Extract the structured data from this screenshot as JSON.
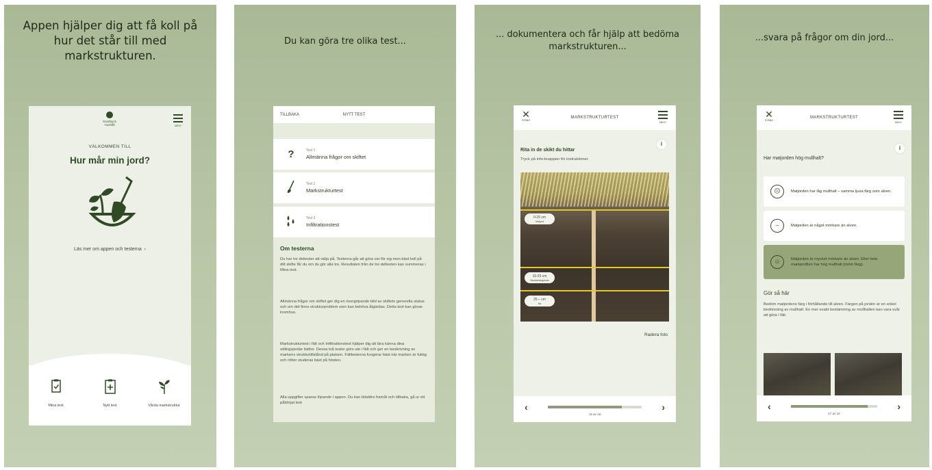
{
  "captions": {
    "p1": "Appen hjälper dig att få koll på hur det står till med markstrukturen.",
    "p2": "Du kan göra tre olika test...",
    "p3": "... dokumentera och får hjälp att bedöma markstrukturen...",
    "p4": "...svara på frågor om din jord..."
  },
  "screen1": {
    "logo_text": "Svartbyns Hushåll",
    "menu_label": "MENY",
    "welcome": "VÄLKOMMEN TILL",
    "title": "Hur mår min jord?",
    "more_link": "Läs mer om appen och testerna",
    "tabs": [
      {
        "label": "Mina test",
        "icon": "clipboard-check-icon"
      },
      {
        "label": "Nytt test",
        "icon": "clipboard-plus-icon"
      },
      {
        "label": "Vårda markstruktur",
        "icon": "sprout-icon"
      }
    ]
  },
  "screen2": {
    "back": "TILLBAKA",
    "title": "NYTT TEST",
    "tests": [
      {
        "small": "Test 1",
        "name": "Allmänna frågor om skiftet",
        "icon": "question-icon"
      },
      {
        "small": "Test 2",
        "name": "Markstrukturtest",
        "icon": "shovel-icon"
      },
      {
        "small": "Test 3",
        "name": "Infiltrationstest",
        "icon": "droplets-icon"
      }
    ],
    "about_title": "Om testerna",
    "paragraphs": [
      "Du har tre deltester att välja på. Testerna går att göra var för sig men bäst koll på ditt skifte får du om du gör alla tre. Resultaten från de tre deltesten kan summeras i Mina test.",
      "Allmänna frågor om skiftet ger dig en övergripande bild av skiftets generella status och om det finns strukturproblem som kan behöva åtgärdas. Detta test kan göras inomhus.",
      "Markstrukturtest i fält och Infiltrationstest hjälper dig att lära känna dina odlingsjordar bättre. Dessa två tester görs ute i fält och ger en beskrivning av markens strukturtillstånd på platsen. Fälttesterna fungerar bäst när marken är fuktig och rötter studeras bäst på hösten.",
      "Alla uppgifter sparas löpande i appen. Du kan bläddra framåt och tillbaka, gå ur ett påbörjat test"
    ]
  },
  "screen3": {
    "close": "STÄNG",
    "title": "MARKSTRUKTURTEST",
    "menu_label": "MENY",
    "heading": "Rita in de skikt du hittar",
    "subheading": "Tryck på info-knappen för instruktioner.",
    "layers": [
      "0-25 cm",
      "10-25 cm",
      "25 – cm"
    ],
    "layer_sub": [
      "Matjord",
      "Bearbetningssula",
      "Alv"
    ],
    "delete": "Radera foto",
    "progress_text": "15 av 19",
    "progress": 0.79
  },
  "screen4": {
    "close": "STÄNG",
    "title": "MARKSTRUKTURTEST",
    "menu_label": "MENY",
    "question": "Har matjorden hög mullhalt?",
    "options": [
      {
        "text": "Matjorden har låg mullhalt – samma ljusa färg som alven.",
        "icon": "frown-face-icon",
        "selected": false
      },
      {
        "text": "Matjorden är något mörkare än alven.",
        "icon": "neutral-face-icon",
        "selected": false
      },
      {
        "text": "Matjorden är mycket mörkare än alven. Eller hela markprofilen har hög mullhalt (mörk färg).",
        "icon": "smile-face-icon",
        "selected": true
      }
    ],
    "how_title": "Gör så här",
    "how_text": "Bedöm matjordens färg i förhållande till alven. Färgen på jorden är en enkel bedömning av mullhalt. En mer exakt bestämning av mullhalten kan vara svår att göra i fält.",
    "progress_text": "17 av 19",
    "progress": 0.89
  }
}
